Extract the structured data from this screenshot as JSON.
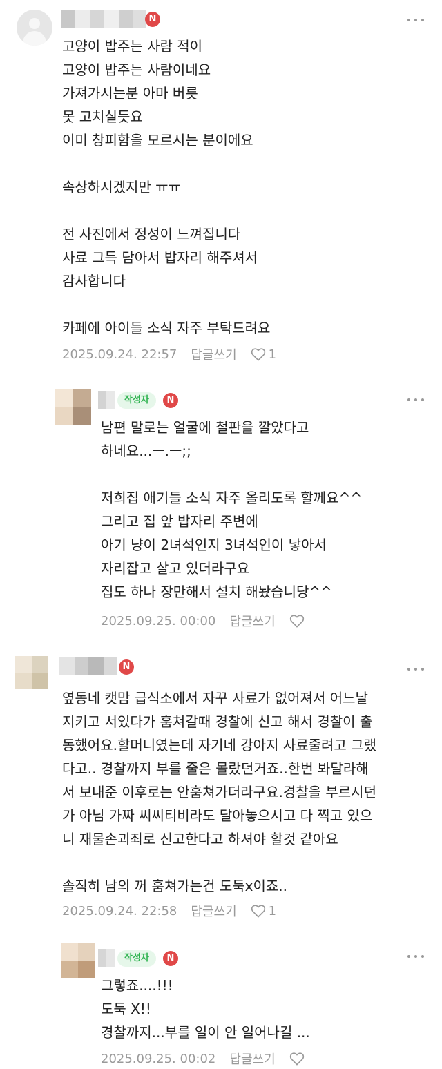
{
  "comments": [
    {
      "nickname_badge": "N",
      "text": "고양이 밥주는 사람 적이\n고양이 밥주는 사람이네요\n가져가시는분 아마 버릇\n못 고치실듯요\n이미 창피함을 모르시는 분이에요\n\n속상하시겠지만 ㅠㅠ\n\n전 사진에서 정성이 느껴집니다\n사료 그득 담아서 밥자리 해주셔서\n감사합니다\n\n카페에 아이들 소식 자주 부탁드려요",
      "date": "2025.09.24. 22:57",
      "reply_label": "답글쓰기",
      "likes": "1"
    },
    {
      "writer_badge": "작성자",
      "nickname_badge": "N",
      "text": "남편 말로는 얼굴에 철판을 깔았다고\n하네요...ㅡ.ㅡ;;\n\n저희집 애기들 소식 자주 올리도록 할께요^^\n그리고 집 앞 밥자리 주변에\n아기 냥이 2녀석인지 3녀석인이 낳아서\n자리잡고 살고 있더라구요\n집도 하나 장만해서 설치 해놨습니당^^",
      "date": "2025.09.25. 00:00",
      "reply_label": "답글쓰기",
      "likes": ""
    },
    {
      "nickname_badge": "N",
      "text": "옆동네 캣맘 급식소에서 자꾸 사료가 없어져서 어느날\n지키고 서있다가 훔쳐갈때 경찰에 신고 해서 경찰이 출\n동했어요.할머니였는데 자기네 강아지 사료줄려고 그랬\n다고.. 경찰까지 부를 줄은 몰랐던거죠..한번 봐달라해\n서 보내준 이후로는 안훔쳐가더라구요.경찰을 부르시던\n가 아님 가짜 씨씨티비라도 달아놓으시고 다 찍고 있으\n니 재물손괴죄로 신고한다고 하셔야 할것 같아요\n\n솔직히 남의 꺼 훔쳐가는건 도둑x이죠..",
      "date": "2025.09.24. 22:58",
      "reply_label": "답글쓰기",
      "likes": "1"
    },
    {
      "writer_badge": "작성자",
      "nickname_badge": "N",
      "text": "그렇죠....!!!\n도둑 X!!\n경찰까지...부를 일이 안 일어나길 ...",
      "date": "2025.09.25. 00:02",
      "reply_label": "답글쓰기",
      "likes": ""
    }
  ],
  "icons": {
    "more": "more-vertical-dots-icon",
    "like": "heart-outline-icon"
  },
  "colors": {
    "badge_red": "#e04848",
    "writer_green": "#2eb34f",
    "meta_gray": "#9a9a9a"
  }
}
